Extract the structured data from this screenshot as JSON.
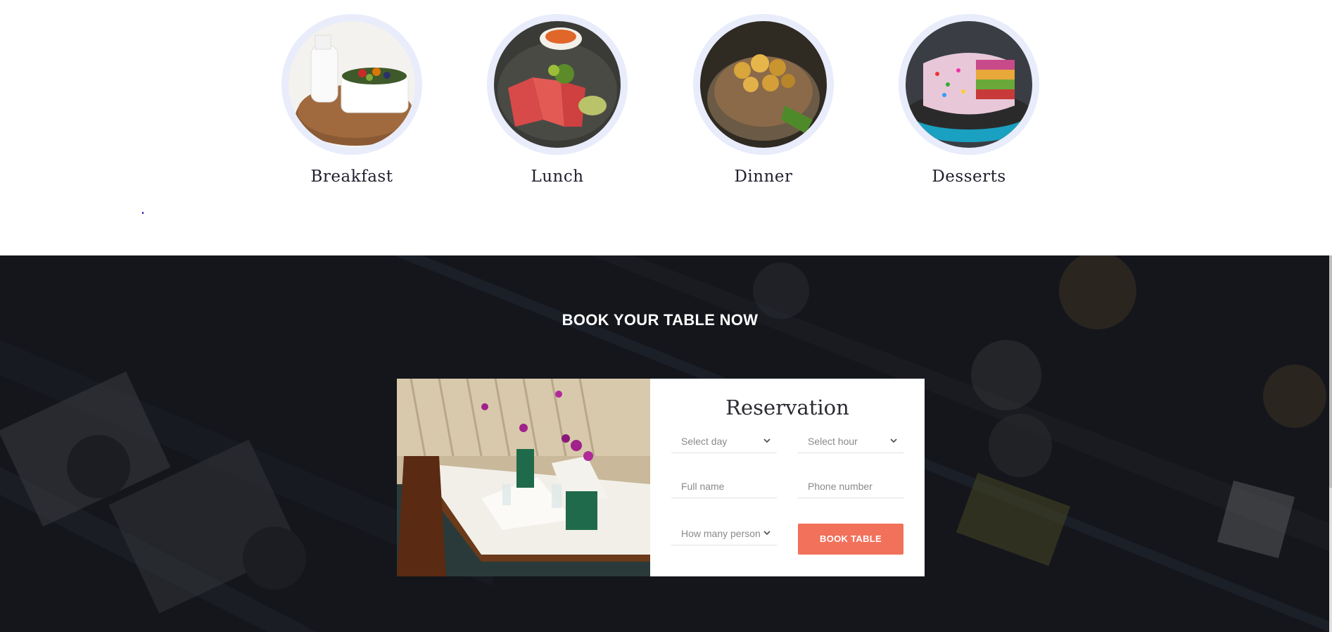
{
  "categories": [
    {
      "label": "Breakfast",
      "icon": "breakfast-photo"
    },
    {
      "label": "Lunch",
      "icon": "lunch-photo"
    },
    {
      "label": "Dinner",
      "icon": "dinner-photo"
    },
    {
      "label": "Desserts",
      "icon": "desserts-photo"
    }
  ],
  "booking": {
    "heading": "BOOK YOUR TABLE NOW",
    "form_title": "Reservation",
    "select_day": "Select day",
    "select_hour": "Select hour",
    "full_name_placeholder": "Full name",
    "phone_placeholder": "Phone number",
    "persons": "How many person",
    "button_label": "BOOK TABLE"
  },
  "colors": {
    "accent": "#f1715b",
    "ring": "#e8ecfb",
    "dark_bg": "#15181d"
  }
}
